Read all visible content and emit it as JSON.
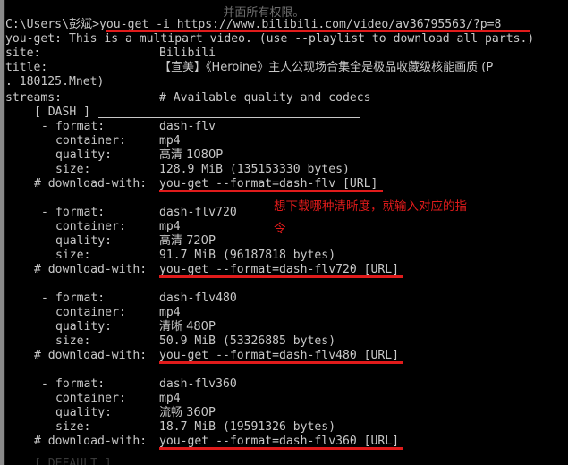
{
  "window": {
    "type": "windows-command-prompt",
    "background_color": "#000000",
    "text_color": "#c8c8c8",
    "annotation_color": "#e01b1b",
    "edge_color": "#8a8a8a"
  },
  "clipped_top_text": "并面所有权限。",
  "prompt_line": {
    "prompt": "C:\\Users\\彭斌>",
    "command": "you-get -i https://www.bilibili.com/video/av36795563/?p=8"
  },
  "output": {
    "multipart_notice": "you-get: This is a multipart video. (use --playlist to download all parts.)",
    "site_label": "site:",
    "site_value": "Bilibili",
    "title_label": "title:",
    "title_value": "【宣美】《Heroine》主人公现场合集全是极品收藏级核能画质 (P",
    "title_value_wrap": ". 180125.Mnet)",
    "streams_label": "streams:",
    "streams_comment": "# Available quality and codecs",
    "section_header": "[ DASH ]"
  },
  "formats": [
    {
      "bullet": "-",
      "format_label": "format:",
      "format_value": "dash-flv",
      "container_label": "container:",
      "container_value": "mp4",
      "quality_label": "quality:",
      "quality_value": "高清 1080P",
      "size_label": "size:",
      "size_value": "128.9 MiB (135153330 bytes)",
      "download_label": "# download-with:",
      "download_value": "you-get --format=dash-flv [URL]",
      "underlined": true
    },
    {
      "bullet": "-",
      "format_label": "format:",
      "format_value": "dash-flv720",
      "container_label": "container:",
      "container_value": "mp4",
      "quality_label": "quality:",
      "quality_value": "高清 720P",
      "size_label": "size:",
      "size_value": "91.7 MiB (96187818 bytes)",
      "download_label": "# download-with:",
      "download_value": "you-get --format=dash-flv720 [URL]",
      "underlined": true
    },
    {
      "bullet": "-",
      "format_label": "format:",
      "format_value": "dash-flv480",
      "container_label": "container:",
      "container_value": "mp4",
      "quality_label": "quality:",
      "quality_value": "清晰 480P",
      "size_label": "size:",
      "size_value": "50.9 MiB (53326885 bytes)",
      "download_label": "# download-with:",
      "download_value": "you-get --format=dash-flv480 [URL]",
      "underlined": true
    },
    {
      "bullet": "-",
      "format_label": "format:",
      "format_value": "dash-flv360",
      "container_label": "container:",
      "container_value": "mp4",
      "quality_label": "quality:",
      "quality_value": "流畅 360P",
      "size_label": "size:",
      "size_value": "18.7 MiB (19591326 bytes)",
      "download_label": "# download-with:",
      "download_value": "you-get --format=dash-flv360 [URL]",
      "underlined": true
    }
  ],
  "annotation": {
    "text": "想下载哪种清晰度，就输入对应的指令"
  },
  "clipped_bottom_text": "[ DEFAULT ]"
}
